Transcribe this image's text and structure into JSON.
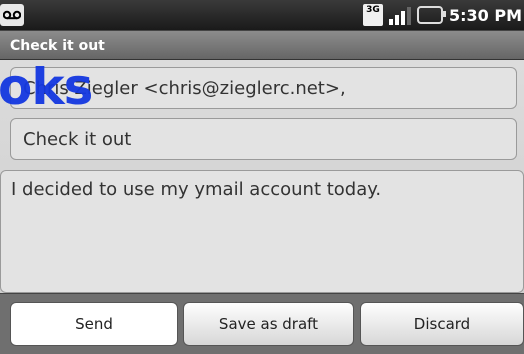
{
  "status": {
    "network": "3G",
    "time": "5:30 PM"
  },
  "window": {
    "title": "Check it out"
  },
  "compose": {
    "to": "Chris Ziegler <chris@zieglerc.net>,",
    "subject": "Check it out",
    "body": "I decided to use my ymail account today.",
    "overlay": "oks"
  },
  "buttons": {
    "send": "Send",
    "save_draft": "Save as draft",
    "discard": "Discard"
  },
  "colors": {
    "overlay_blue": "#1438e0",
    "title_bar_gray": "#777777"
  }
}
